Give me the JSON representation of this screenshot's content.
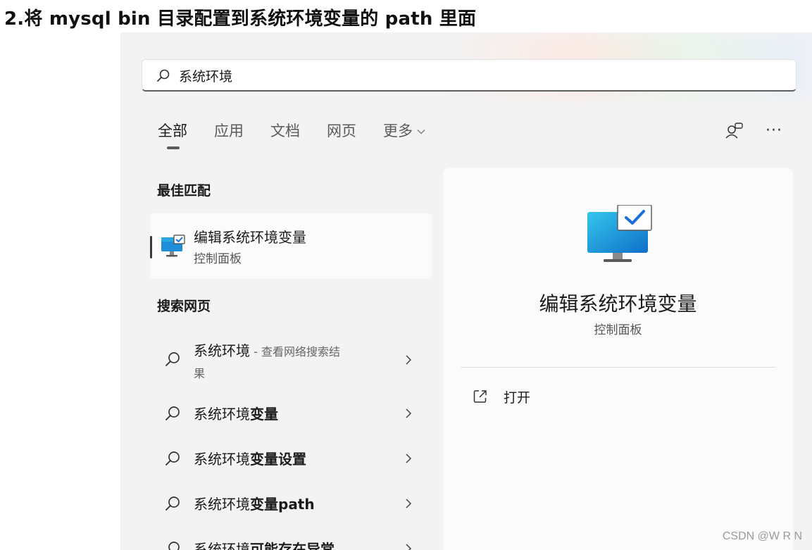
{
  "page_heading": "2.将 mysql bin 目录配置到系统环境变量的 path 里面",
  "search": {
    "value": "系统环境",
    "icon": "search-icon"
  },
  "tabs": [
    {
      "label": "全部",
      "active": true
    },
    {
      "label": "应用",
      "active": false
    },
    {
      "label": "文档",
      "active": false
    },
    {
      "label": "网页",
      "active": false
    },
    {
      "label": "更多",
      "active": false
    }
  ],
  "tab_icons": {
    "share_icon": "share-people-icon",
    "more_icon": "ellipsis-icon",
    "more_text": "···"
  },
  "best_match": {
    "section_title": "最佳匹配",
    "title": "编辑系统环境变量",
    "subtitle": "控制面板",
    "icon": "monitor-check-icon"
  },
  "web_search": {
    "section_title": "搜索网页",
    "results": [
      {
        "plain": "系统环境",
        "bold": "",
        "extra": " - 查看网络搜索结",
        "wrap": "果"
      },
      {
        "plain": "系统环境",
        "bold": "变量",
        "extra": "",
        "wrap": ""
      },
      {
        "plain": "系统环境",
        "bold": "变量设置",
        "extra": "",
        "wrap": ""
      },
      {
        "plain": "系统环境",
        "bold": "变量path",
        "extra": "",
        "wrap": ""
      },
      {
        "plain": "系统环境",
        "bold": "可能存在异常",
        "extra": "",
        "wrap": ""
      }
    ]
  },
  "detail": {
    "title": "编辑系统环境变量",
    "subtitle": "控制面板",
    "action_label": "打开",
    "action_icon": "open-external-icon"
  },
  "watermark": "CSDN @W R N",
  "colors": {
    "panel_bg": "#f3f3f3",
    "card_bg": "#fbfbfb",
    "accent_dark": "#3a3a3a",
    "monitor_blue": "#0f7fd0"
  }
}
